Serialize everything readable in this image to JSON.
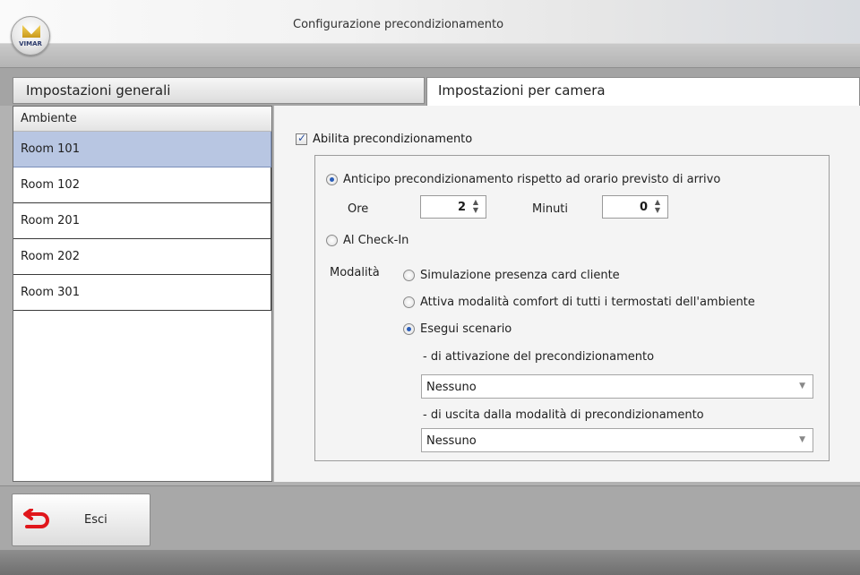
{
  "window": {
    "title": "Configurazione precondizionamento",
    "logo_text": "VIMAR"
  },
  "tabs": [
    {
      "label": "Impostazioni generali",
      "active": false
    },
    {
      "label": "Impostazioni per camera",
      "active": true
    }
  ],
  "rooms": {
    "header": "Ambiente",
    "items": [
      "Room 101",
      "Room 102",
      "Room 201",
      "Room 202",
      "Room 301"
    ],
    "selected": "Room 101"
  },
  "settings": {
    "enable_label": "Abilita precondizionamento",
    "enable_checked": true,
    "anticipo_label": "Anticipo precondizionamento rispetto ad orario previsto di arrivo",
    "anticipo_selected": true,
    "ore_label": "Ore",
    "ore_value": "2",
    "minuti_label": "Minuti",
    "minuti_value": "0",
    "checkin_label": "Al Check-In",
    "checkin_selected": false,
    "modalita_label": "Modalità",
    "mode_options": [
      {
        "label": "Simulazione presenza card cliente",
        "selected": false
      },
      {
        "label": "Attiva modalità comfort di tutti i termostati dell'ambiente",
        "selected": false
      },
      {
        "label": "Esegui scenario",
        "selected": true
      }
    ],
    "activation_label": "- di attivazione del precondizionamento",
    "activation_value": "Nessuno",
    "exit_label": "- di uscita dalla modalità di precondizionamento",
    "exit_value": "Nessuno"
  },
  "footer": {
    "exit_button_label": "Esci",
    "exit_icon": "undo-arrow-icon",
    "accent_color": "#e0161b"
  }
}
